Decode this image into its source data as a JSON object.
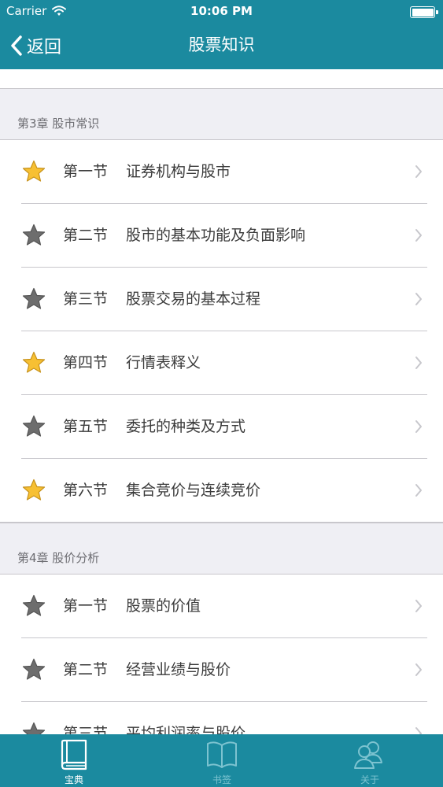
{
  "status": {
    "carrier": "Carrier",
    "time": "10:06 PM",
    "battery_level": 1.0
  },
  "nav": {
    "back_label": "返回",
    "title": "股票知识"
  },
  "colors": {
    "accent": "#1b8a9f",
    "star_gold": "#f7c033",
    "star_gray": "#6d6d6d"
  },
  "chapters": [
    {
      "header": "第3章 股市常识",
      "sections": [
        {
          "num": "第一节",
          "title": "证券机构与股市",
          "starred": true
        },
        {
          "num": "第二节",
          "title": "股市的基本功能及负面影响",
          "starred": false
        },
        {
          "num": "第三节",
          "title": "股票交易的基本过程",
          "starred": false
        },
        {
          "num": "第四节",
          "title": "行情表释义",
          "starred": true
        },
        {
          "num": "第五节",
          "title": "委托的种类及方式",
          "starred": false
        },
        {
          "num": "第六节",
          "title": "集合竞价与连续竞价",
          "starred": true
        }
      ]
    },
    {
      "header": "第4章 股价分析",
      "sections": [
        {
          "num": "第一节",
          "title": "股票的价值",
          "starred": false
        },
        {
          "num": "第二节",
          "title": "经营业绩与股价",
          "starred": false
        },
        {
          "num": "第三节",
          "title": "平均利润率与股价",
          "starred": false
        }
      ]
    }
  ],
  "tabs": [
    {
      "label": "宝典",
      "icon": "book-closed-icon",
      "active": true
    },
    {
      "label": "书签",
      "icon": "book-open-icon",
      "active": false
    },
    {
      "label": "关于",
      "icon": "people-icon",
      "active": false
    }
  ]
}
